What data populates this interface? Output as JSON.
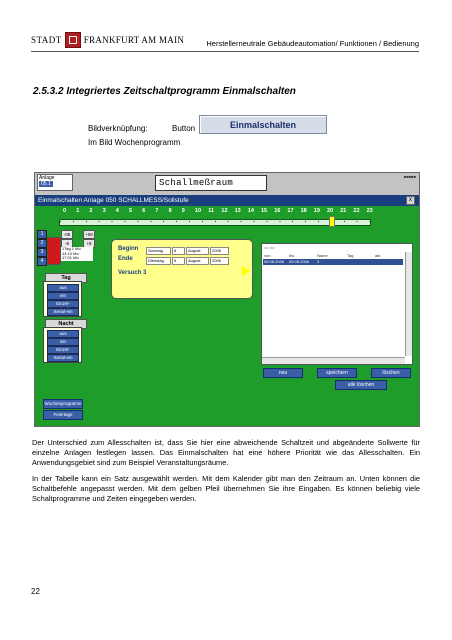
{
  "header": {
    "logo_word1": "STADT",
    "logo_word2": "FRANKFURT AM MAIN",
    "right_text": "Herstellerneutrale Gebäudeautomation/ Funktionen / Bedienung"
  },
  "section_title": "2.5.3.2 Integriertes Zeitschaltprogramm Einmalschalten",
  "bildverknuepfung": {
    "label": "Bildverknüpfung:",
    "type": "Button",
    "button_label": "Einmalschalten",
    "sub": "Im Bild Wochenprogramm"
  },
  "screenshot": {
    "anlage_label": "Anlage",
    "anlage_value": "05.1",
    "room_name": "Schallmeßraum",
    "window_title": "Einmalschalten  Anlage 050 SCHALLMESS/Sollstufe",
    "close": "x",
    "hours": [
      "0",
      "1",
      "2",
      "3",
      "4",
      "5",
      "6",
      "7",
      "8",
      "9",
      "10",
      "11",
      "12",
      "13",
      "14",
      "15",
      "16",
      "17",
      "18",
      "19",
      "20",
      "21",
      "22",
      "23"
    ],
    "controls": {
      "nums": [
        "1",
        "2",
        "3",
        "4"
      ],
      "btns": [
        "-08",
        "+08",
        "-8",
        "+8"
      ],
      "date_lines": [
        "1Tag 1 Mo",
        "14.10 Mo",
        "17.01 Mo"
      ]
    },
    "tag": {
      "label": "Tag",
      "items": [
        "aus",
        "ein",
        "Einzel-Freigabe",
        "Serial-ein"
      ]
    },
    "nacht": {
      "label": "Nacht",
      "items": [
        "aus",
        "ein",
        "Einzel-Freigabe",
        "Serial-ein"
      ]
    },
    "yellow": {
      "beginn_label": "Beginn",
      "ende_label": "Ende",
      "beginn_fields": [
        "Sonntag",
        "6",
        "August",
        "2006"
      ],
      "ende_fields": [
        "Dienstag",
        "9",
        "August",
        "2006"
      ],
      "versuch": "Versuch 3"
    },
    "table": {
      "headers": [
        "von",
        "bis",
        "Name",
        "Tag",
        "akt"
      ],
      "row": [
        "06.08.2006",
        "09.08.2006",
        "3",
        "",
        ""
      ]
    },
    "buttons": {
      "neu": "neu",
      "speichern": "speichern",
      "loeschen": "löschen",
      "alle_loeschen": "alle löschen",
      "wochenprogramm": "Wochenprogramm",
      "feiertage": "Feiertage"
    }
  },
  "paragraphs": [
    "Der Unterschied zum Allesschalten ist, dass Sie hier eine abweichende Schaltzeit und abgeänderte Sollwerte für einzelne Anlagen festlegen lassen. Das Einmalschalten hat eine höhere Priorität wie das Allesschalten. Ein Anwendungsgebiet sind zum Beispiel Veranstaltungsräume.",
    "In der Tabelle kann ein Satz ausgewählt werden. Mit dem Kalender gibt man den Zeitraum an. Unten können die Schaltbefehle angepasst werden. Mit dem gelben Pfeil übernehmen Sie ihre Eingaben. Es können beliebig viele Schaltprogramme und Zeiten eingegeben werden."
  ],
  "page_number": "22"
}
